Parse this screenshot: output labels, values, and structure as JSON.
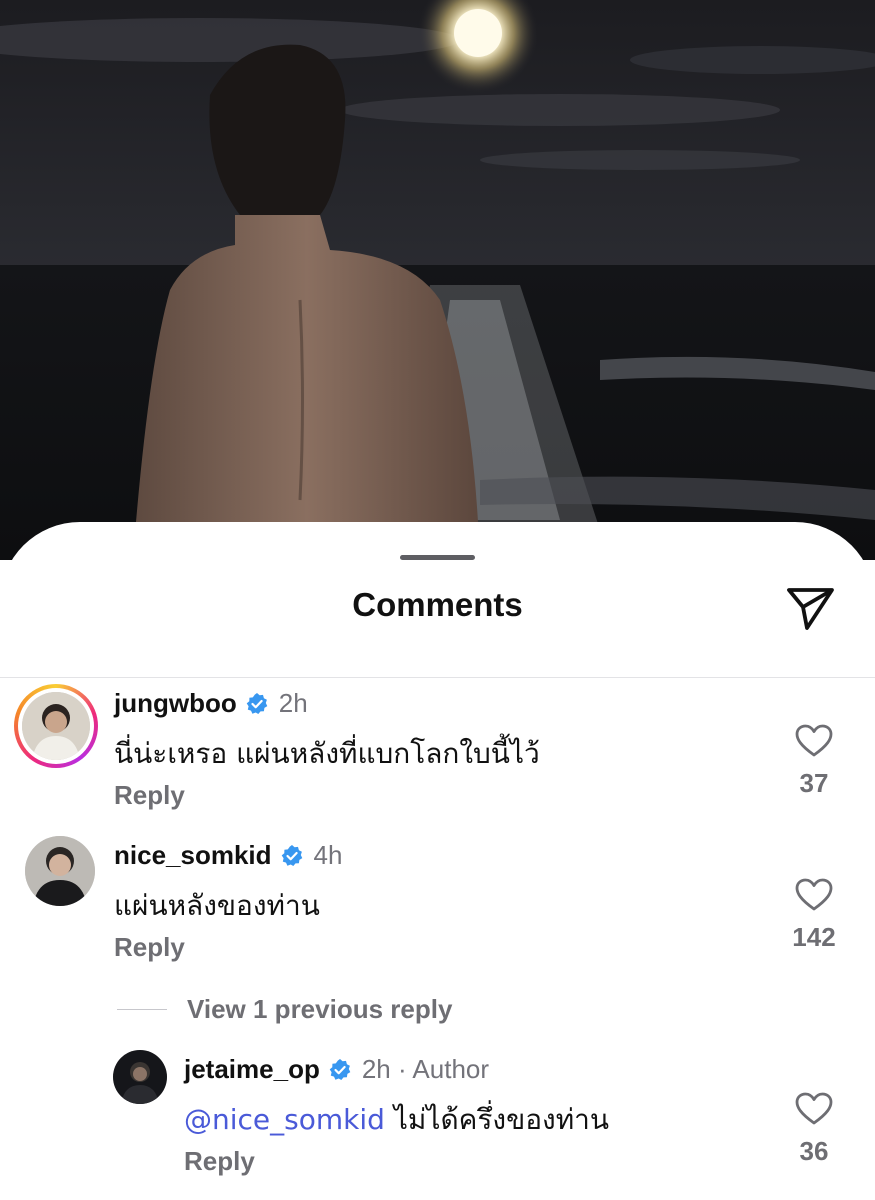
{
  "sheet": {
    "title": "Comments",
    "share_icon": "paper-plane-icon"
  },
  "comments": [
    {
      "username": "jungwboo",
      "verified": true,
      "time": "2h",
      "text": "นี่น่ะเหรอ แผ่นหลังที่แบกโลกใบนี้ไว้",
      "reply_label": "Reply",
      "likes": "37",
      "has_story": true
    },
    {
      "username": "nice_somkid",
      "verified": true,
      "time": "4h",
      "text": "แผ่นหลังของท่าน",
      "reply_label": "Reply",
      "likes": "142",
      "has_story": false
    }
  ],
  "view_replies_label": "View 1 previous reply",
  "reply": {
    "username": "jetaime_op",
    "verified": true,
    "time": "2h · Author",
    "mention": "@nice_somkid",
    "text": "ไม่ได้ครึ่งของท่าน",
    "reply_label": "Reply",
    "likes": "36"
  },
  "colors": {
    "verified_badge": "#3897f0",
    "mention": "#4a5ad8",
    "secondary_text": "#6e6e73"
  }
}
